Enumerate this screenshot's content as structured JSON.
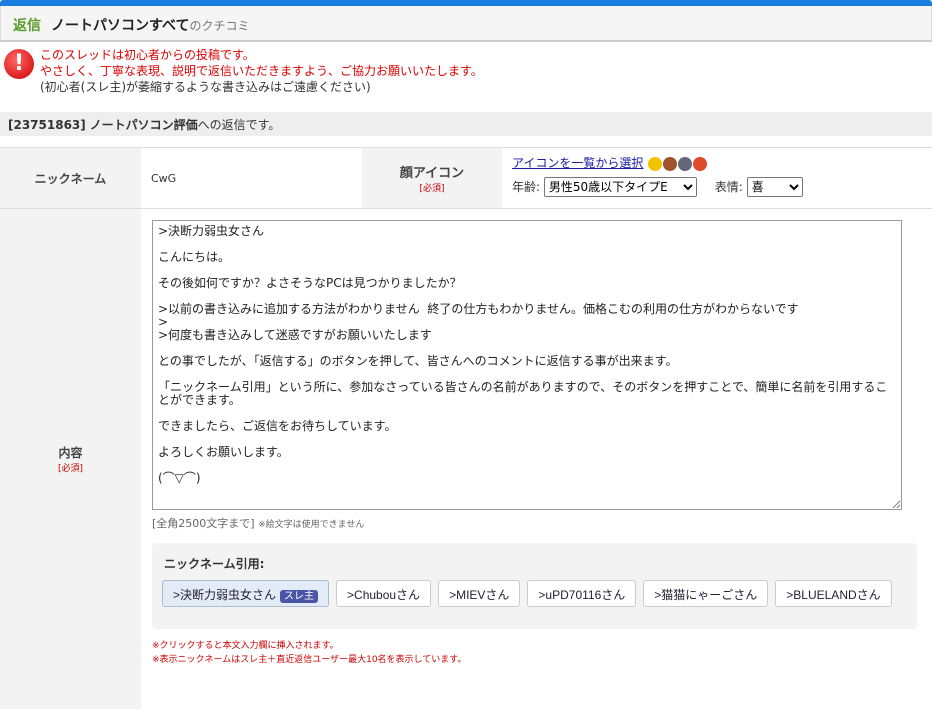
{
  "header": {
    "reply": "返信",
    "title": "ノートパソコンすべて",
    "suffix": "のクチコミ"
  },
  "warning": {
    "icon": "exclamation-icon",
    "line1": "このスレッドは初心者からの投稿です。",
    "line2": "やさしく、丁寧な表現、説明で返信いただきますよう、ご協力お願いいたします。",
    "line3": "(初心者(スレ主)が萎縮するような書き込みはご遠慮ください)"
  },
  "reply_to": {
    "id": "[23751863]",
    "title": "ノートパソコン評価",
    "suffix": "への返信です。"
  },
  "form": {
    "nickname_label": "ニックネーム",
    "nickname_value": "CwG",
    "face_label": "顔アイコン",
    "required": "[必須]",
    "face_link": "アイコンを一覧から選択",
    "age_label": "年齢:",
    "age_value": "男性50歳以下タイプE",
    "expr_label": "表情:",
    "expr_value": "喜",
    "content_label": "内容",
    "content_value": ">決断力弱虫女さん\n\nこんにちは。\n\nその後如何ですか？よさそうなPCは見つかりましたか？\n\n>以前の書き込みに追加する方法がわかりません  終了の仕方もわかりません。価格こむの利用の仕方がわからないです\n>\n>何度も書き込みして迷惑ですがお願いいたします\n\nとの事でしたが、「返信する」のボタンを押して、皆さんへのコメントに返信する事が出来ます。\n\n「ニックネーム引用」という所に、参加なさっている皆さんの名前がありますので、そのボタンを押すことで、簡単に名前を引用することができます。\n\nできましたら、ご返信をお待ちしています。\n\nよろしくお願いします。\n\n(⌒▽⌒)",
    "limit": "[全角2500文字まで]",
    "emoji_note": "※絵文字は使用できません"
  },
  "quote": {
    "title": "ニックネーム引用:",
    "owner_badge": "スレ主",
    "names": [
      ">決断力弱虫女さん",
      ">Chubouさん",
      ">MIEVさん",
      ">uPD70116さん",
      ">猫猫にゃーごさん",
      ">BLUELANDさん"
    ],
    "note1": "※クリックすると本文入力欄に挿入されます。",
    "note2": "※表示ニックネームはスレ主＋直近返信ユーザー最大10名を表示しています。"
  },
  "colors": {
    "accent": "#1a7de0",
    "warning": "#dd0000"
  }
}
